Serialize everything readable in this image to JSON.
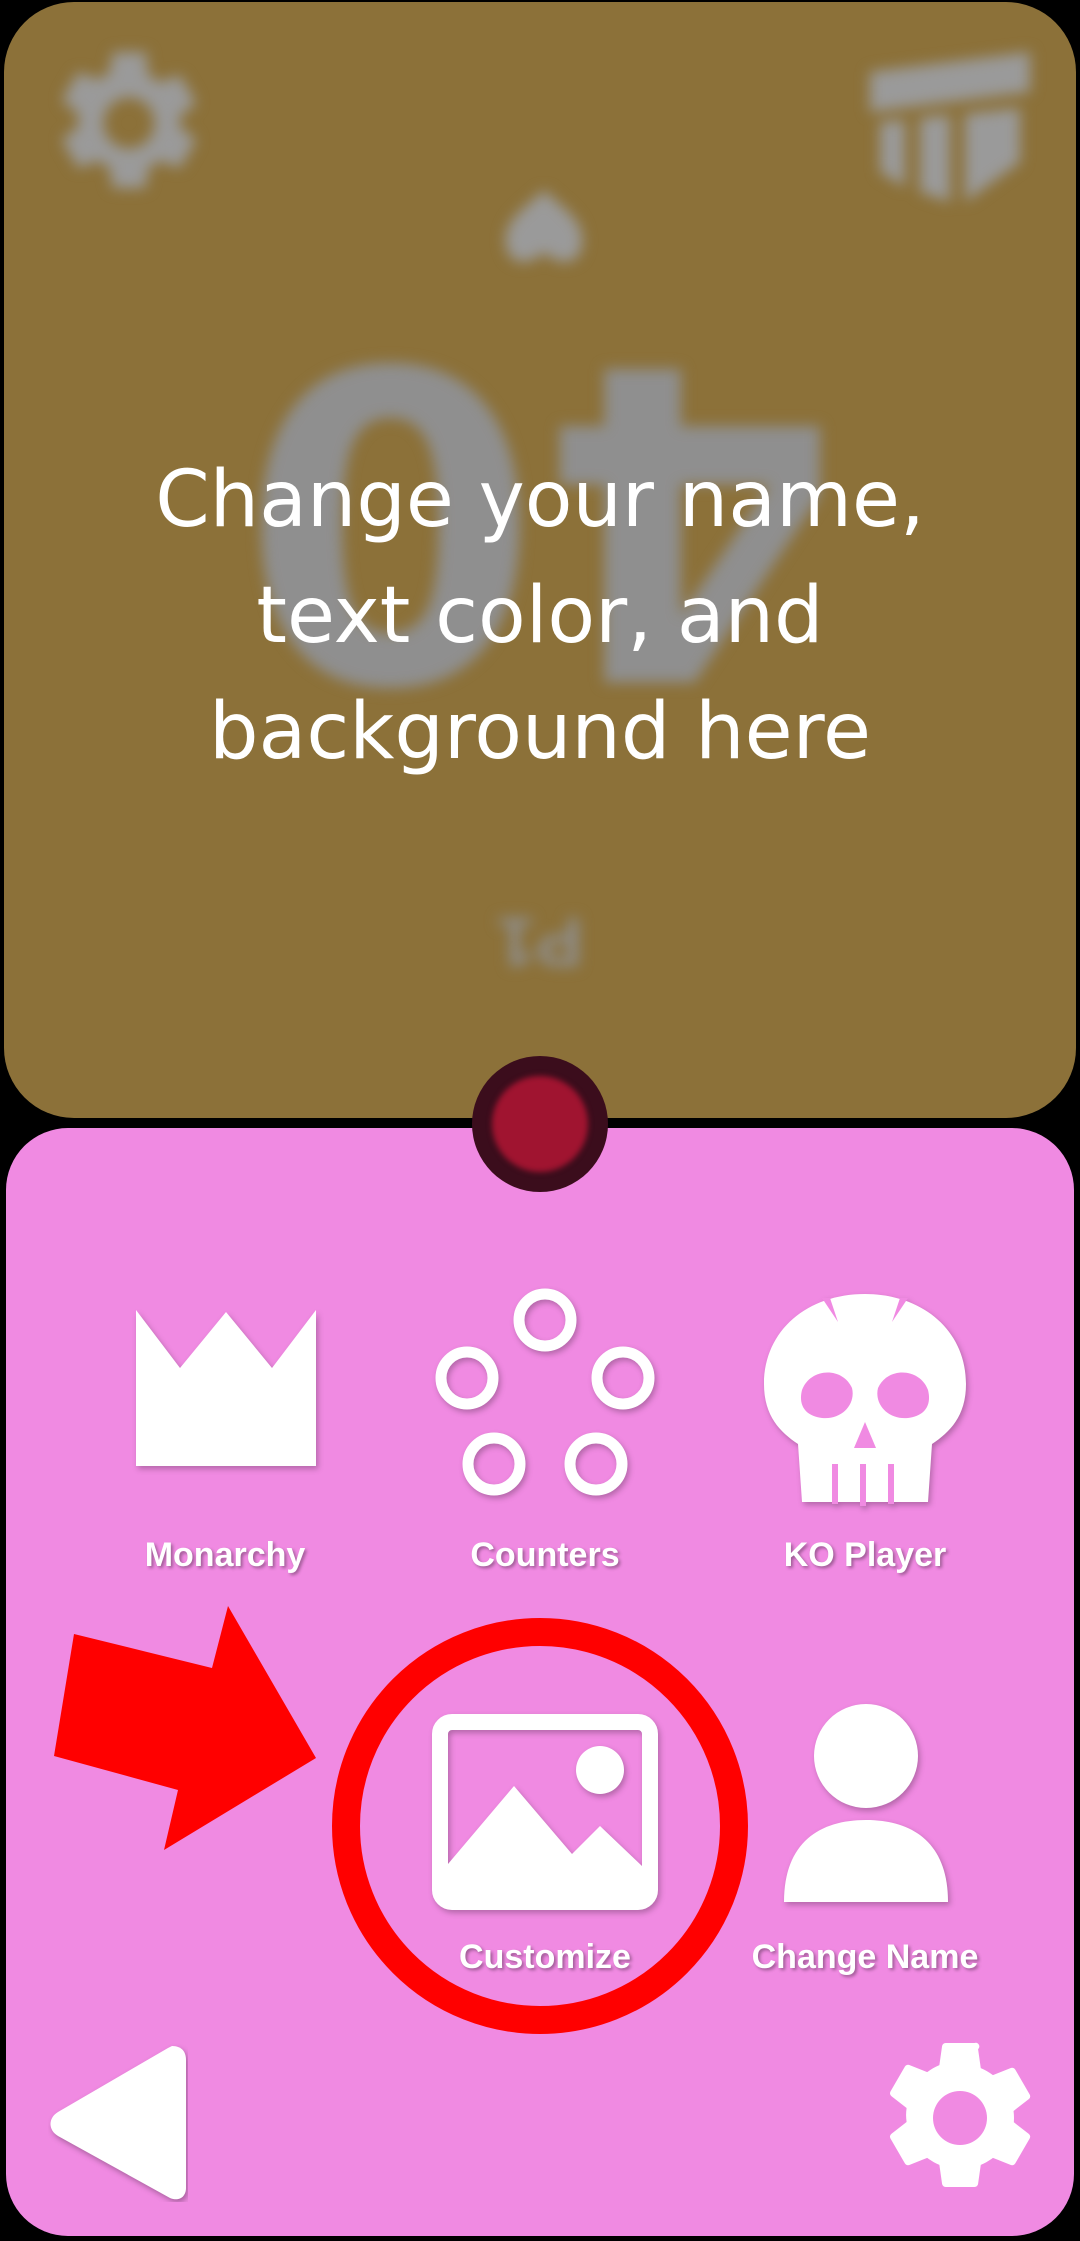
{
  "top_panel": {
    "life_total": "40",
    "player_label": "P1",
    "hint_text": "Change your name,\ntext color, and\nbackground here",
    "background": "#8c7139"
  },
  "bottom_panel": {
    "background": "#f08ae2",
    "menu": [
      {
        "label": "Monarchy",
        "icon": "crown-icon"
      },
      {
        "label": "Counters",
        "icon": "counters-icon"
      },
      {
        "label": "KO Player",
        "icon": "skull-icon"
      },
      {
        "label": "Customize",
        "icon": "image-icon"
      },
      {
        "label": "Change Name",
        "icon": "person-icon"
      }
    ],
    "back_icon": "back-arrow-icon",
    "settings_icon": "gear-icon"
  },
  "annotation": {
    "arrow_color": "#ff0000",
    "circle_color": "#ff0000"
  }
}
